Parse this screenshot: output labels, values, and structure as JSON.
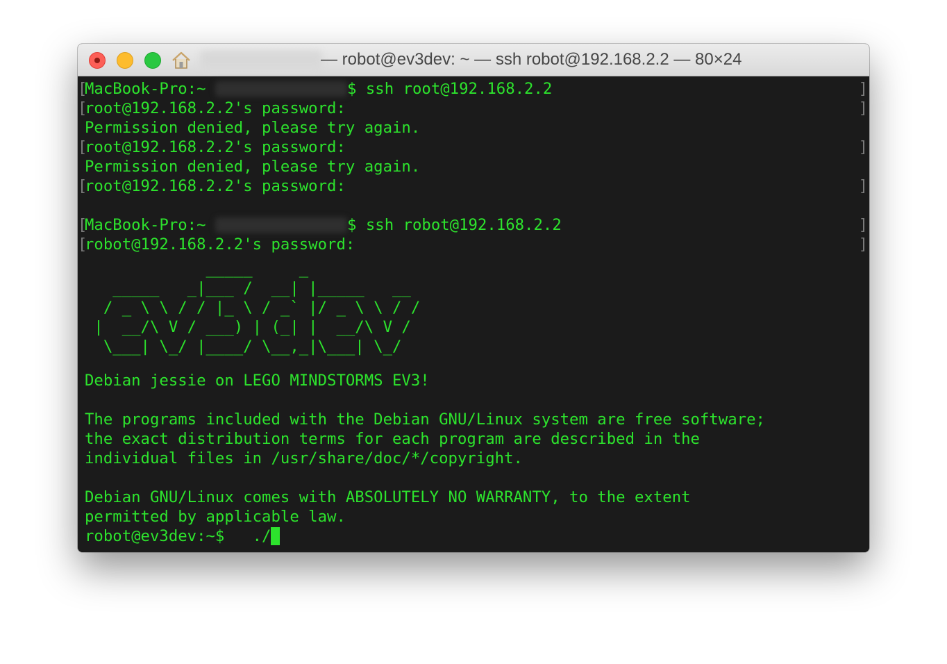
{
  "window": {
    "title": "— robot@ev3dev: ~ — ssh robot@192.168.2.2 — 80×24",
    "colors": {
      "terminal_background": "#1b1b1b",
      "terminal_text": "#2de32d",
      "titlebar": "#e3e3e3",
      "close": "#fc5f57",
      "minimize": "#fdbc2e",
      "zoom": "#2ac841"
    },
    "icons": {
      "close": "close-button",
      "minimize": "minimize-button",
      "zoom": "zoom-button",
      "proxy": "home-folder-icon"
    }
  },
  "terminal": {
    "lines": {
      "l01_prompt": "MacBook-Pro:~",
      "l01_cmd": "$ ssh root@192.168.2.2",
      "l02": "root@192.168.2.2's password:",
      "l03": "Permission denied, please try again.",
      "l04": "root@192.168.2.2's password:",
      "l05": "Permission denied, please try again.",
      "l06": "root@192.168.2.2's password:",
      "l08_prompt": "MacBook-Pro:~",
      "l08_cmd": "$ ssh robot@192.168.2.2",
      "l09": "robot@192.168.2.2's password:",
      "l16": "Debian jessie on LEGO MINDSTORMS EV3!",
      "l18": "The programs included with the Debian GNU/Linux system are free software;",
      "l19": "the exact distribution terms for each program are described in the",
      "l20": "individual files in /usr/share/doc/*/copyright.",
      "l22": "Debian GNU/Linux comes with ABSOLUTELY NO WARRANTY, to the extent",
      "l23": "permitted by applicable law.",
      "l24": "robot@ev3dev:~$   ./"
    },
    "banner": "             _____     _\n   _____   _|___ /  __| |_____   __\n  / _ \\ \\ / / |_ \\ / _` |/ _ \\ \\ / /\n |  __/\\ V / ___) | (_| |  __/\\ V /\n  \\___| \\_/ |____/ \\__,_|\\___| \\_/",
    "marks": {
      "left": "[",
      "right": "]"
    }
  }
}
